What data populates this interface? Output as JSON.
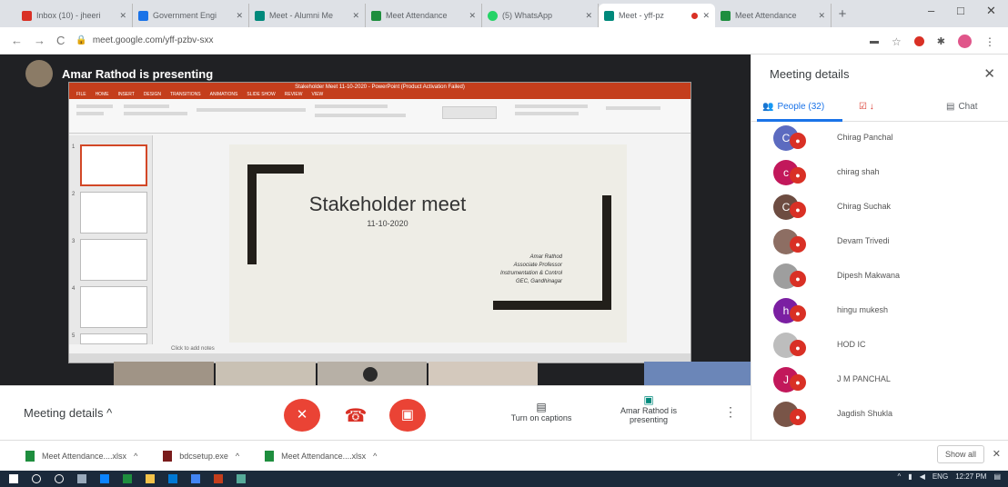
{
  "browser": {
    "tabs": [
      {
        "title": "Inbox (10) - jheeri",
        "color": "#d93025"
      },
      {
        "title": "Government Engi",
        "color": "#1a73e8"
      },
      {
        "title": "Meet - Alumni Me",
        "color": "#00897b"
      },
      {
        "title": "Meet Attendance",
        "color": "#1e8e3e"
      },
      {
        "title": "(5) WhatsApp",
        "color": "#25d366"
      },
      {
        "title": "Meet - yff-pz",
        "color": "#00897b"
      },
      {
        "title": "Meet Attendance",
        "color": "#1e8e3e"
      }
    ],
    "url": "meet.google.com/yff-pzbv-sxx",
    "new_tab": "+",
    "window_controls": [
      "–",
      "□",
      "✕"
    ]
  },
  "stage": {
    "presenter_name": "Amar Rathod is presenting",
    "ppt": {
      "title_bar": "Stakeholder Meet 11-10-2020 - PowerPoint (Product Activation Failed)",
      "menu": [
        "FILE",
        "HOME",
        "INSERT",
        "DESIGN",
        "TRANSITIONS",
        "ANIMATIONS",
        "SLIDE SHOW",
        "REVIEW",
        "VIEW"
      ],
      "slide_numbers": [
        "1",
        "2",
        "3",
        "4",
        "5"
      ],
      "slide": {
        "title": "Stakeholder meet",
        "date": "11-10-2020",
        "lines": [
          "Amar Rathod",
          "Associate Professor",
          "Instrumentation & Control",
          "GEC, Gandhinagar"
        ]
      },
      "notes_placeholder": "Click to add notes"
    }
  },
  "bottom_bar": {
    "meeting_details": "Meeting details",
    "captions": "Turn on captions",
    "presenting": "Amar Rathod is presenting"
  },
  "panel": {
    "title": "Meeting details",
    "tabs": {
      "people": "People (32)",
      "chat": "Chat"
    },
    "people": [
      {
        "initial": "C",
        "name": "Chirag Panchal",
        "color": "#5c6bc0"
      },
      {
        "initial": "c",
        "name": "chirag shah",
        "color": "#c2185b"
      },
      {
        "initial": "C",
        "name": "Chirag Suchak",
        "color": "#6d4c41"
      },
      {
        "initial": "",
        "name": "Devam Trivedi",
        "color": "#8d6e63"
      },
      {
        "initial": "",
        "name": "Dipesh Makwana",
        "color": "#9e9e9e"
      },
      {
        "initial": "h",
        "name": "hingu mukesh",
        "color": "#7b1fa2"
      },
      {
        "initial": "",
        "name": "HOD IC",
        "color": "#bdbdbd"
      },
      {
        "initial": "J",
        "name": "J M PANCHAL",
        "color": "#c2185b"
      },
      {
        "initial": "",
        "name": "Jagdish Shukla",
        "color": "#795548"
      }
    ]
  },
  "downloads": [
    {
      "name": "Meet Attendance....xlsx"
    },
    {
      "name": "bdcsetup.exe"
    },
    {
      "name": "Meet Attendance....xlsx"
    }
  ],
  "show_all": "Show all",
  "tray": {
    "lang": "ENG",
    "time": "12:27 PM"
  }
}
